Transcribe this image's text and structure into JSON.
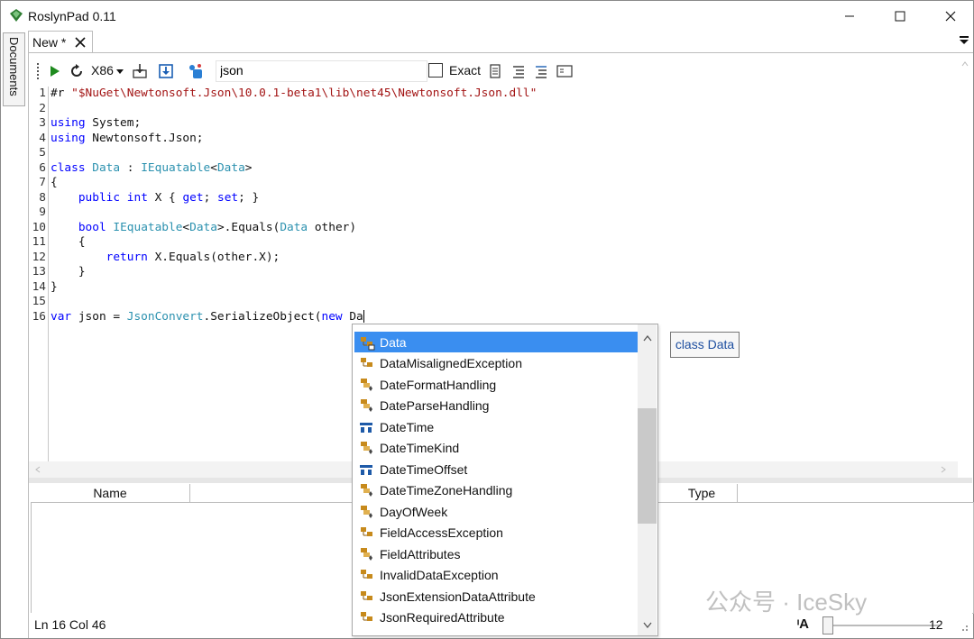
{
  "window": {
    "title": "RoslynPad 0.11"
  },
  "sidebar": {
    "documents_label": "Documents"
  },
  "tab": {
    "label": "New *"
  },
  "toolbar": {
    "platform": "X86",
    "search_value": "json",
    "exact_label": "Exact"
  },
  "editor": {
    "line_numbers": [
      "1",
      "2",
      "3",
      "4",
      "5",
      "6",
      "7",
      "8",
      "9",
      "10",
      "11",
      "12",
      "13",
      "14",
      "15",
      "16"
    ]
  },
  "grid": {
    "col_name": "Name",
    "col_type": "Type"
  },
  "autocomplete": {
    "items": [
      {
        "label": "Data",
        "icon": "class-private-icon",
        "selected": true
      },
      {
        "label": "DataMisalignedException",
        "icon": "class-icon"
      },
      {
        "label": "DateFormatHandling",
        "icon": "enum-icon"
      },
      {
        "label": "DateParseHandling",
        "icon": "enum-icon"
      },
      {
        "label": "DateTime",
        "icon": "struct-icon"
      },
      {
        "label": "DateTimeKind",
        "icon": "enum-icon"
      },
      {
        "label": "DateTimeOffset",
        "icon": "struct-icon"
      },
      {
        "label": "DateTimeZoneHandling",
        "icon": "enum-icon"
      },
      {
        "label": "DayOfWeek",
        "icon": "enum-icon"
      },
      {
        "label": "FieldAccessException",
        "icon": "class-icon"
      },
      {
        "label": "FieldAttributes",
        "icon": "enum-icon"
      },
      {
        "label": "InvalidDataException",
        "icon": "class-icon"
      },
      {
        "label": "JsonExtensionDataAttribute",
        "icon": "class-icon"
      },
      {
        "label": "JsonRequiredAttribute",
        "icon": "class-icon"
      }
    ]
  },
  "tooltip": {
    "text": "class Data"
  },
  "status": {
    "position": "Ln 16 Col 46",
    "zoom": "12"
  },
  "watermark": {
    "text": "公众号 · IceSky"
  },
  "colors": {
    "keyword": "#0000ff",
    "type": "#2b91af",
    "string": "#a31515",
    "selection": "#3a8ef0"
  }
}
